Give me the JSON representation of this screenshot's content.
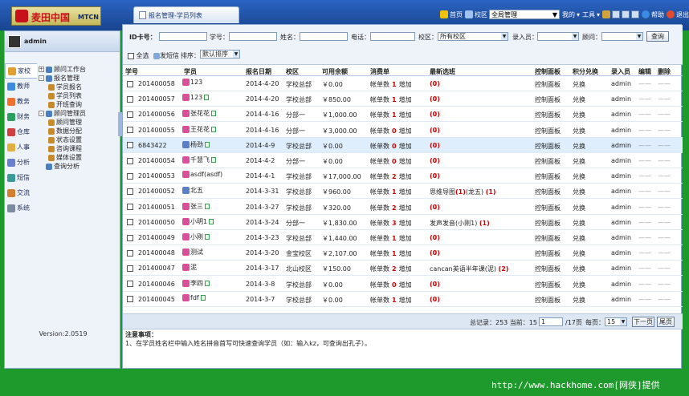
{
  "brand": {
    "name_cn": "麦田中国",
    "name_en": "MTCN"
  },
  "tab": {
    "title": "报名管理-学员列表"
  },
  "toolbar": {
    "home": "首页",
    "campus_label": "校区",
    "campus_value": "全局管理",
    "mine": "我的",
    "tools": "工具",
    "help": "帮助",
    "exit": "退出"
  },
  "user": {
    "name": "admin"
  },
  "modules": [
    "家校",
    "教师",
    "教务",
    "财务",
    "仓库",
    "人事",
    "分析",
    "短信",
    "交流",
    "系统"
  ],
  "tree": [
    {
      "label": "顾问工作台",
      "level": 0,
      "toggle": "+"
    },
    {
      "label": "报名管理",
      "level": 0,
      "toggle": "-"
    },
    {
      "label": "学员报名",
      "level": 1
    },
    {
      "label": "学员列表",
      "level": 1
    },
    {
      "label": "开班查询",
      "level": 1
    },
    {
      "label": "顾问管理员",
      "level": 0,
      "toggle": "-"
    },
    {
      "label": "顾问管理",
      "level": 1
    },
    {
      "label": "数据分配",
      "level": 1
    },
    {
      "label": "状态设置",
      "level": 1
    },
    {
      "label": "咨询课程",
      "level": 1
    },
    {
      "label": "媒体设置",
      "level": 1
    },
    {
      "label": "查询分析",
      "level": 0
    }
  ],
  "version": "Version:2.0519",
  "filter": {
    "id_label": "ID卡号：",
    "student_no_label": "学号：",
    "name_label": "姓名：",
    "phone_label": "电话：",
    "campus_label": "校区：",
    "campus_value": "所有校区",
    "recorder_label": "录入员：",
    "advisor_label": "顾问：",
    "query": "查询",
    "select_all": "全选",
    "send_sms": "发短信",
    "sort_label": "排序：",
    "sort_value": "默认排序"
  },
  "columns": [
    "学号",
    "学员",
    "报名日期",
    "校区",
    "可用余额",
    "消费单",
    "最新选班",
    "控制面板",
    "积分兑换",
    "录入员",
    "编辑",
    "删除"
  ],
  "rows": [
    {
      "no": "201400058",
      "name": "123",
      "date": "2014-4-20",
      "campus": "学校总部",
      "bal": "￥0.00",
      "cnt": "1",
      "course": "(0)",
      "f": true,
      "memo": false
    },
    {
      "no": "201400057",
      "name": "123",
      "date": "2014-4-20",
      "campus": "学校总部",
      "bal": "￥850.00",
      "cnt": "1",
      "course": "(0)",
      "f": true,
      "memo": true
    },
    {
      "no": "201400056",
      "name": "张花花",
      "date": "2014-4-16",
      "campus": "分部一",
      "bal": "￥1,000.00",
      "cnt": "1",
      "course": "(0)",
      "f": true,
      "memo": true
    },
    {
      "no": "201400055",
      "name": "王花花",
      "date": "2014-4-16",
      "campus": "分部一",
      "bal": "￥3,000.00",
      "cnt": "0",
      "course": "(0)",
      "f": true,
      "memo": true
    },
    {
      "no": "6843422",
      "name": "杨劲",
      "date": "2014-4-9",
      "campus": "学校总部",
      "bal": "￥0.00",
      "cnt": "0",
      "course": "(0)",
      "f": false,
      "memo": true
    },
    {
      "no": "201400054",
      "name": "千慧飞",
      "date": "2014-4-2",
      "campus": "分部一",
      "bal": "￥0.00",
      "cnt": "0",
      "course": "(0)",
      "f": true,
      "memo": true
    },
    {
      "no": "201400053",
      "name": "asdf(asdf)",
      "date": "2014-4-1",
      "campus": "学校总部",
      "bal": "￥17,000.00",
      "cnt": "2",
      "course": "(0)",
      "f": true,
      "memo": false
    },
    {
      "no": "201400052",
      "name": "北五",
      "date": "2014-3-31",
      "campus": "学校总部",
      "bal": "￥960.00",
      "cnt": "1",
      "course": "思维导图(1)(龙五) (1)",
      "f": false,
      "memo": false
    },
    {
      "no": "201400051",
      "name": "张三",
      "date": "2014-3-27",
      "campus": "学校总部",
      "bal": "￥320.00",
      "cnt": "2",
      "course": "(0)",
      "f": true,
      "memo": true
    },
    {
      "no": "201400050",
      "name": "小明1",
      "date": "2014-3-24",
      "campus": "分部一",
      "bal": "￥1,830.00",
      "cnt": "3",
      "course": "发声发音(小刚1) (1)",
      "f": true,
      "memo": true
    },
    {
      "no": "201400049",
      "name": "小刚",
      "date": "2014-3-23",
      "campus": "学校总部",
      "bal": "￥1,440.00",
      "cnt": "1",
      "course": "(0)",
      "f": true,
      "memo": true
    },
    {
      "no": "201400048",
      "name": "测试",
      "date": "2014-3-20",
      "campus": "金宝校区",
      "bal": "￥2,107.00",
      "cnt": "1",
      "course": "(0)",
      "f": true,
      "memo": false
    },
    {
      "no": "201400047",
      "name": "泥",
      "date": "2014-3-17",
      "campus": "北山校区",
      "bal": "￥150.00",
      "cnt": "2",
      "course": "cancan英语半年课(泥) (2)",
      "f": true,
      "memo": false
    },
    {
      "no": "201400046",
      "name": "李四",
      "date": "2014-3-8",
      "campus": "学校总部",
      "bal": "￥0.00",
      "cnt": "0",
      "course": "(0)",
      "f": true,
      "memo": true
    },
    {
      "no": "201400045",
      "name": "fdf",
      "date": "2014-3-7",
      "campus": "学校总部",
      "bal": "￥0.00",
      "cnt": "1",
      "course": "(0)",
      "f": true,
      "memo": true
    }
  ],
  "row_static": {
    "cnt_label": "帐单数",
    "add": "增加",
    "panel": "控制面板",
    "redeem": "兑换",
    "recorder": "admin",
    "dash": "——"
  },
  "pager": {
    "total": "总记录：253 当前：15",
    "page_value": "1",
    "page_total": "/17页",
    "per_page_label": "每页：",
    "per_page_value": "15",
    "next": "下一页",
    "last": "尾页"
  },
  "notice": {
    "title": "注意事项：",
    "text": "1、在学员姓名栏中输入姓名拼音首写可快速查询学员（如：输入kz，可查询出孔子）。"
  },
  "footer": "http://www.hackhome.com[网侠]提供"
}
